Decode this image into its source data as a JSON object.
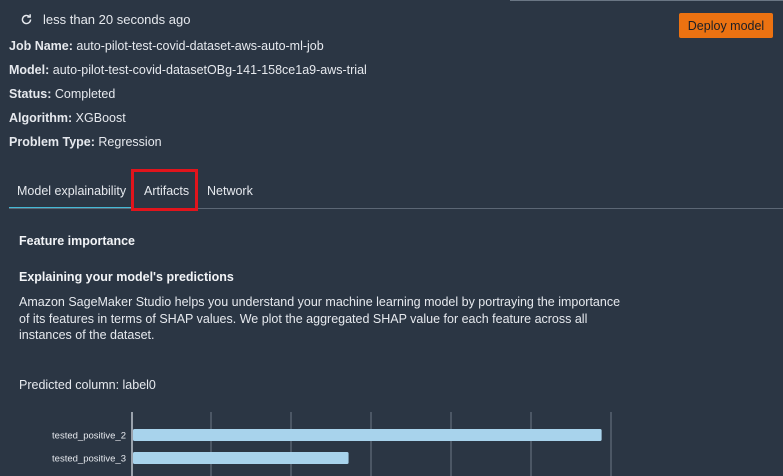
{
  "header": {
    "refresh_text": "less than 20 seconds ago",
    "deploy_label": "Deploy model"
  },
  "details": {
    "job_name": {
      "label": "Job Name:",
      "value": "auto-pilot-test-covid-dataset-aws-auto-ml-job"
    },
    "model": {
      "label": "Model:",
      "value": "auto-pilot-test-covid-datasetOBg-141-158ce1a9-aws-trial"
    },
    "status": {
      "label": "Status:",
      "value": "Completed"
    },
    "algorithm": {
      "label": "Algorithm:",
      "value": "XGBoost"
    },
    "problem_type": {
      "label": "Problem Type:",
      "value": "Regression"
    }
  },
  "tabs": [
    {
      "label": "Model explainability",
      "active": true
    },
    {
      "label": "Artifacts",
      "active": false,
      "highlighted": true
    },
    {
      "label": "Network",
      "active": false
    }
  ],
  "content": {
    "feature_importance_title": "Feature importance",
    "explaining_title": "Explaining your model's predictions",
    "explaining_text": "Amazon SageMaker Studio helps you understand your machine learning model by portraying the importance of its features in terms of SHAP values. We plot the aggregated SHAP value for each feature across all instances of the dataset.",
    "predicted_column": "Predicted column: label0"
  },
  "colors": {
    "background": "#2b3644",
    "accent_orange": "#ec7211",
    "tab_underline": "#44b9d6",
    "highlight_red": "#e1141c",
    "bar_fill": "#a8d3ec"
  },
  "chart_data": {
    "type": "bar",
    "orientation": "horizontal",
    "categories": [
      "tested_positive_2",
      "tested_positive_3"
    ],
    "values": [
      1.0,
      0.46
    ],
    "xlim": [
      0,
      1.02
    ],
    "grid": true
  }
}
